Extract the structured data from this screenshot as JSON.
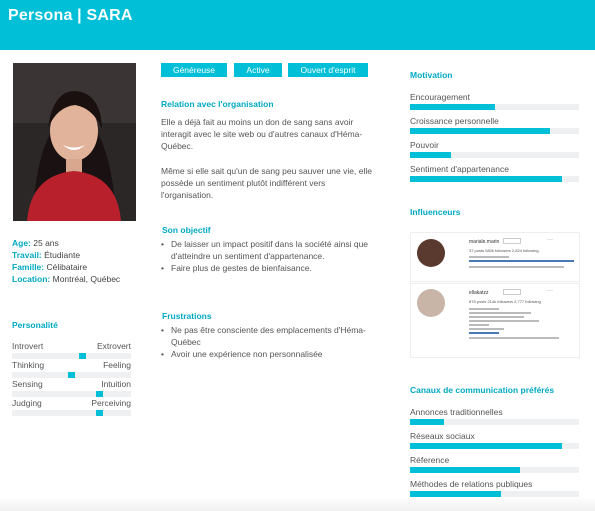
{
  "header": {
    "title": "Persona | SARA"
  },
  "profile": {
    "age_key": "Age:",
    "age_val": " 25 ans",
    "travail_key": "Travail:",
    "travail_val": " Étudiante",
    "famille_key": "Famille:",
    "famille_val": " Célibataire",
    "location_key": "Location:",
    "location_val": " Montréal, Québec"
  },
  "personality": {
    "title": "Personalité",
    "traits": [
      {
        "left": "Introvert",
        "right": "Extrovert",
        "position": 0.6
      },
      {
        "left": "Thinking",
        "right": "Feeling",
        "position": 0.5
      },
      {
        "left": "Sensing",
        "right": "Intuition",
        "position": 0.75
      },
      {
        "left": "Judging",
        "right": "Perceiving",
        "position": 0.75
      }
    ]
  },
  "tags": [
    "Généreuse",
    "Active",
    "Ouvert d'esprit"
  ],
  "relation": {
    "title": "Relation avec l'organisation",
    "lines1": [
      "Elle a déjà fait au moins un don de sang sans avoir",
      "interagit avec le site web ou d'autres canaux d'Héma-",
      "Québec."
    ],
    "lines2": [
      "Même si elle sait qu'un de sang peu sauver une vie, elle",
      "possède un sentiment plutôt indifférent vers",
      "l'organisation."
    ]
  },
  "objectif": {
    "title": "Son objectif",
    "items": [
      [
        "De laisser un impact positif dans la société ainsi que",
        "d'atteindre un sentiment d'appartenance."
      ],
      [
        "Faire plus de gestes de bienfaisance."
      ]
    ]
  },
  "frustrations": {
    "title": "Frustrations",
    "items": [
      [
        "Ne pas être consciente des emplacements d'Héma-",
        "Québec"
      ],
      [
        "Avoir une expérience non personnalisée"
      ]
    ]
  },
  "motivation": {
    "title": "Motivation",
    "items": [
      {
        "label": "Encouragement",
        "value": 0.5
      },
      {
        "label": "Croissance personnelle",
        "value": 0.83
      },
      {
        "label": "Pouvoir",
        "value": 0.24
      },
      {
        "label": "Sentiment d'appartenance",
        "value": 0.9
      }
    ]
  },
  "influenceurs": {
    "title": "Influenceurs",
    "cards": [
      {
        "name": "mariale.marin",
        "stats": "37 posts   583k followers   2,824 following",
        "avatar_color": "#5a3a2e"
      },
      {
        "name": "ellakatzz",
        "stats": "878 posts   214k followers   2,777 following",
        "avatar_color": "#c8b5a8"
      }
    ]
  },
  "canaux": {
    "title": "Canaux de communication préférés",
    "items": [
      {
        "label": "Annonces traditionnelles",
        "value": 0.2
      },
      {
        "label": "Réseaux sociaux",
        "value": 0.9
      },
      {
        "label": "Réference",
        "value": 0.65
      },
      {
        "label": "Méthodes de relations publiques",
        "value": 0.54
      }
    ]
  },
  "colors": {
    "accent": "#00bfd6",
    "track": "#eef0f2",
    "heading": "#00a9c2"
  }
}
